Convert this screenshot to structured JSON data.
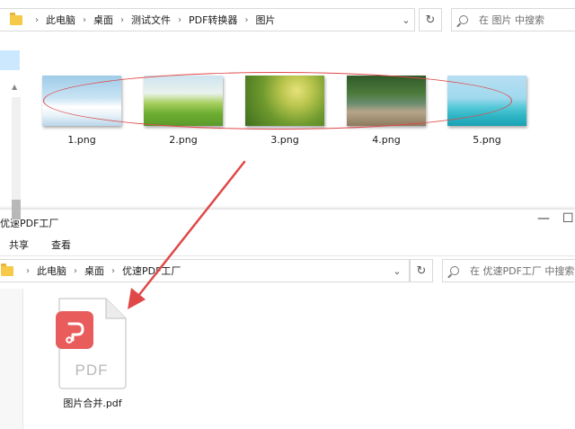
{
  "window1": {
    "breadcrumb": [
      "此电脑",
      "桌面",
      "测试文件",
      "PDF转换器",
      "图片"
    ],
    "search_placeholder": "在 图片 中搜索",
    "files": [
      {
        "name": "1.png",
        "icon": "image-thumbnail"
      },
      {
        "name": "2.png",
        "icon": "image-thumbnail"
      },
      {
        "name": "3.png",
        "icon": "image-thumbnail"
      },
      {
        "name": "4.png",
        "icon": "image-thumbnail"
      },
      {
        "name": "5.png",
        "icon": "image-thumbnail"
      }
    ]
  },
  "window2": {
    "title": "优速PDF工厂",
    "ribbon_tabs": [
      "共享",
      "查看"
    ],
    "breadcrumb": [
      "此电脑",
      "桌面",
      "优速PDF工厂"
    ],
    "search_placeholder": "在 优速PDF工厂 中搜索",
    "files": [
      {
        "name": "图片合并.pdf",
        "icon": "pdf-file-icon",
        "icon_text": "PDF"
      }
    ]
  },
  "annotation": {
    "color": "#e04848"
  },
  "colors": {
    "folder": "#f7c948",
    "selection": "#cce8ff",
    "pdf_badge": "#e85c5c"
  }
}
